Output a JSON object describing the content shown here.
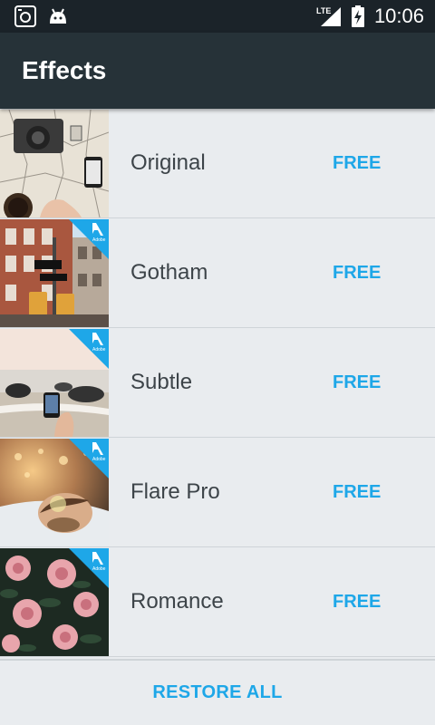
{
  "status_bar": {
    "time": "10:06",
    "network": "LTE",
    "icons": [
      "camera-notification-icon",
      "android-notification-icon",
      "lte-signal-icon",
      "battery-charging-icon"
    ]
  },
  "app_bar": {
    "title": "Effects"
  },
  "effects": [
    {
      "name": "Original",
      "price": "FREE",
      "adobe_badge": false,
      "thumbnail": "map-desk-camera-photo"
    },
    {
      "name": "Gotham",
      "price": "FREE",
      "adobe_badge": true,
      "thumbnail": "city-street-sign-photo"
    },
    {
      "name": "Subtle",
      "price": "FREE",
      "adobe_badge": true,
      "thumbnail": "beach-phone-photo"
    },
    {
      "name": "Flare Pro",
      "price": "FREE",
      "adobe_badge": true,
      "thumbnail": "man-lying-sunset-photo"
    },
    {
      "name": "Romance",
      "price": "FREE",
      "adobe_badge": true,
      "thumbnail": "pink-roses-photo"
    }
  ],
  "badge_text": "Adobe",
  "bottom": {
    "restore_label": "RESTORE ALL"
  },
  "colors": {
    "status_bar": "#1b2329",
    "app_bar": "#263238",
    "accent": "#1ea7e8",
    "list_bg": "#e9ecef",
    "text": "#3d4449"
  }
}
